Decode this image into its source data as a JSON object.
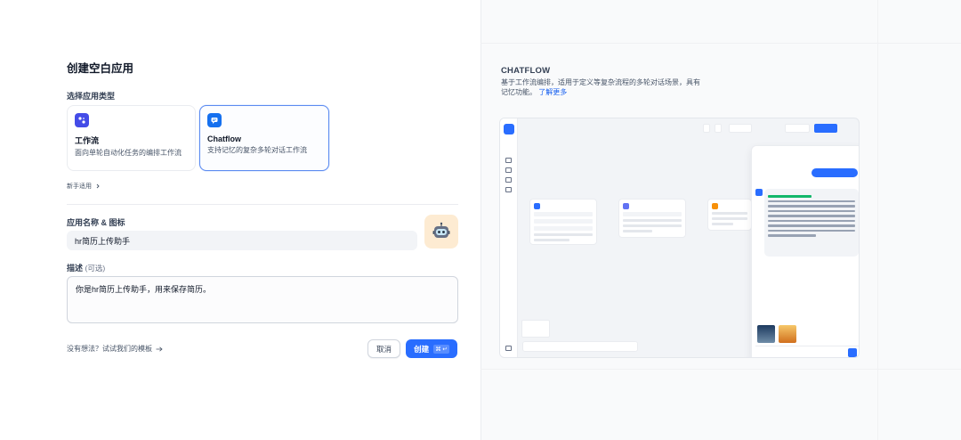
{
  "dialog": {
    "title": "创建空白应用",
    "type_label": "选择应用类型",
    "types": [
      {
        "name": "工作流",
        "desc": "面向单轮自动化任务的编排工作流",
        "selected": false
      },
      {
        "name": "Chatflow",
        "desc": "支持记忆的复杂多轮对话工作流",
        "selected": true
      }
    ],
    "newbie_link": "新手适用",
    "name_label": "应用名称 & 图标",
    "name_value": "hr简历上传助手",
    "desc_label": "描述",
    "desc_optional": "(可选)",
    "desc_value": "你是hr简历上传助手，用来保存简历。",
    "template_link": "没有想法？试试我们的模板",
    "cancel_label": "取消",
    "create_label": "创建",
    "create_shortcut": "⌘ ↵",
    "avatar_icon": "robot-icon"
  },
  "preview_panel": {
    "title": "CHATFLOW",
    "desc": "基于工作流编排，适用于定义等复杂流程的多轮对话场景，具有记忆功能。",
    "learn_more": "了解更多"
  },
  "colors": {
    "primary": "#296dff",
    "selected_border": "#5c8bf0",
    "workflow_icon": "#444ce7",
    "chatflow_icon": "#1570ef"
  }
}
